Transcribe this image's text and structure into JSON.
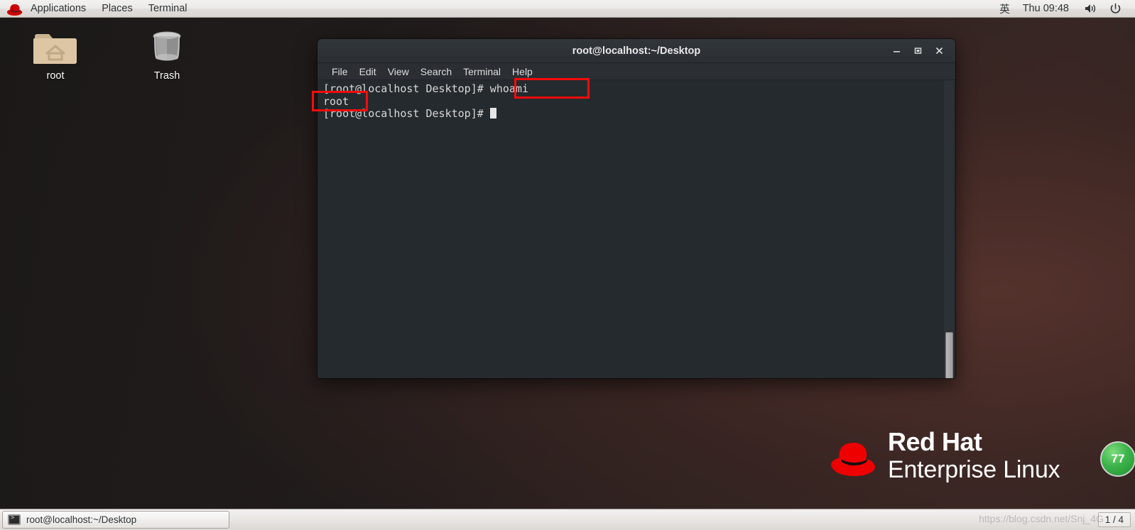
{
  "top_panel": {
    "logo_icon": "redhat-fedora-icon",
    "menus": [
      {
        "label": "Applications",
        "name": "applications-menu"
      },
      {
        "label": "Places",
        "name": "places-menu"
      },
      {
        "label": "Terminal",
        "name": "terminal-menu"
      }
    ],
    "input_method": "英",
    "clock": "Thu 09:48",
    "volume_icon": "speaker-icon",
    "power_icon": "power-icon"
  },
  "desktop": {
    "icons": [
      {
        "label": "root",
        "icon": "home-folder-icon"
      },
      {
        "label": "Trash",
        "icon": "trash-bin-icon"
      }
    ],
    "watermark_logo": {
      "icon": "redhat-hat-icon",
      "line1": "Red Hat",
      "line2": "Enterprise Linux"
    },
    "green_badge": "77",
    "csdn_watermark": "https://blog.csdn.net/Snj_4G"
  },
  "terminal": {
    "title": "root@localhost:~/Desktop",
    "window_buttons": {
      "minimize": "—",
      "maximize": "❐",
      "close": "✕"
    },
    "menu_items": [
      {
        "label": "File",
        "name": "menu-file"
      },
      {
        "label": "Edit",
        "name": "menu-edit"
      },
      {
        "label": "View",
        "name": "menu-view"
      },
      {
        "label": "Search",
        "name": "menu-search"
      },
      {
        "label": "Terminal",
        "name": "menu-terminal"
      },
      {
        "label": "Help",
        "name": "menu-help"
      }
    ],
    "lines": [
      "[root@localhost Desktop]# whoami",
      "root",
      "[root@localhost Desktop]# "
    ],
    "prompt_text": "[root@localhost Desktop]# ",
    "command": "whoami",
    "output": "root"
  },
  "annotations": {
    "highlight_color": "#f60b0b",
    "boxes": [
      {
        "target": "whoami-command"
      },
      {
        "target": "root-output"
      }
    ]
  },
  "taskbar": {
    "window_button": {
      "icon": "terminal-icon",
      "label": "root@localhost:~/Desktop"
    },
    "workspace": "1 / 4"
  }
}
